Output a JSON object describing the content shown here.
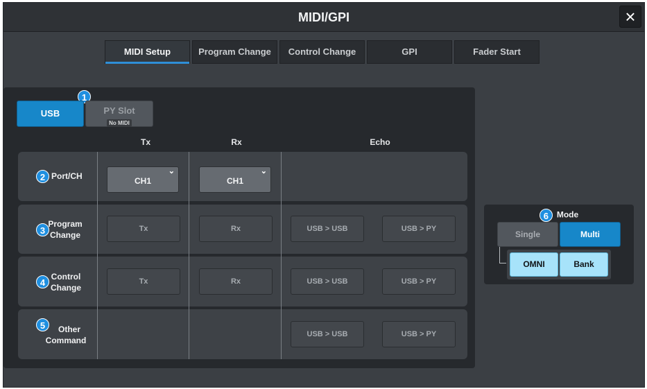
{
  "window": {
    "title": "MIDI/GPI",
    "close_icon": "close-icon"
  },
  "tabs": [
    {
      "label": "MIDI Setup",
      "active": true
    },
    {
      "label": "Program Change",
      "active": false
    },
    {
      "label": "Control Change",
      "active": false
    },
    {
      "label": "GPI",
      "active": false
    },
    {
      "label": "Fader Start",
      "active": false
    }
  ],
  "source": {
    "badge": "1",
    "usb": {
      "label": "USB",
      "selected": true
    },
    "py_slot": {
      "label": "PY Slot",
      "status": "No MIDI",
      "selected": false
    }
  },
  "columns": {
    "tx": "Tx",
    "rx": "Rx",
    "echo": "Echo"
  },
  "rows": {
    "port_ch": {
      "badge": "2",
      "label": "Port/CH",
      "tx_value": "CH1",
      "rx_value": "CH1"
    },
    "program_change": {
      "badge": "3",
      "label_line1": "Program",
      "label_line2": "Change",
      "tx": "Tx",
      "rx": "Rx",
      "echo1": "USB > USB",
      "echo2": "USB > PY"
    },
    "control_change": {
      "badge": "4",
      "label_line1": "Control",
      "label_line2": "Change",
      "tx": "Tx",
      "rx": "Rx",
      "echo1": "USB > USB",
      "echo2": "USB > PY"
    },
    "other_command": {
      "badge": "5",
      "label_line1": "Other",
      "label_line2": "Command",
      "echo1": "USB > USB",
      "echo2": "USB > PY"
    }
  },
  "mode": {
    "badge": "6",
    "title": "Mode",
    "single": "Single",
    "multi": "Multi",
    "selected": "Multi",
    "omni": "OMNI",
    "bank": "Bank"
  },
  "colors": {
    "accent": "#1787c9",
    "panel": "#26292d",
    "light_blue": "#a7e3fa"
  }
}
